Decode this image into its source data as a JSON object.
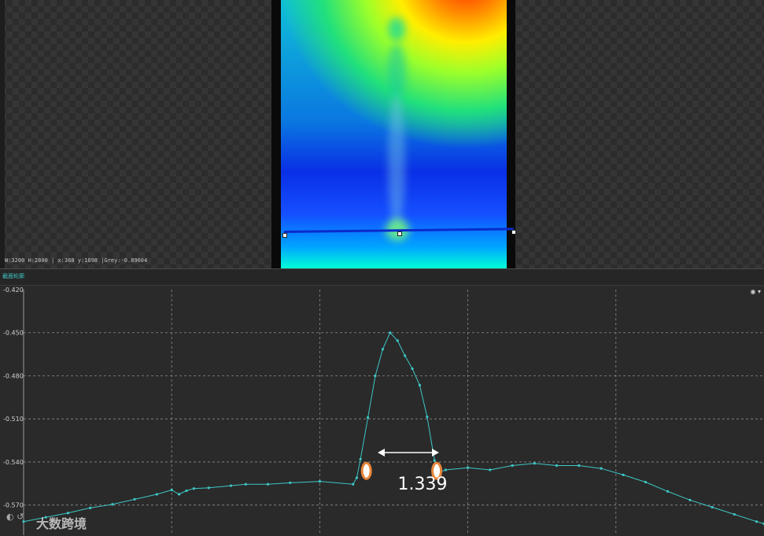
{
  "status_bar": {
    "text": "W:3200 H:2800 | x:368 y:1898 |Grey:-0.89604"
  },
  "profile_panel": {
    "tab_label": "截面轮廓",
    "icon_name": "eye-icon"
  },
  "annotation": {
    "label": "1.339"
  },
  "watermark": {
    "text": "大数跨境"
  },
  "colors": {
    "curve": "#3ec6c6",
    "grid": "#8a8a8a",
    "marker": "#e8863a"
  },
  "chart_data": {
    "type": "line",
    "title": "",
    "xlabel": "",
    "ylabel": "",
    "ylim": [
      -0.591,
      -0.42
    ],
    "yticks": [
      -0.42,
      -0.45,
      -0.48,
      -0.51,
      -0.54,
      -0.57
    ],
    "grid": true,
    "series": [
      {
        "x": [
          0,
          3,
          6,
          9,
          12,
          15,
          18,
          20,
          21,
          22,
          23,
          25,
          28,
          30,
          33,
          36,
          40,
          44.5,
          45,
          45.5,
          46.5,
          47.5,
          48.5,
          49.5,
          50.5,
          51.5,
          52.5,
          53.5,
          54.5,
          55.5,
          56,
          57,
          60,
          63,
          66,
          69,
          72,
          75,
          78,
          81,
          84,
          87,
          90,
          93,
          96,
          99,
          100
        ],
        "y": [
          -0.5815,
          -0.5785,
          -0.5755,
          -0.572,
          -0.5695,
          -0.566,
          -0.5625,
          -0.5595,
          -0.5625,
          -0.56,
          -0.5585,
          -0.558,
          -0.5565,
          -0.5555,
          -0.5555,
          -0.5545,
          -0.5535,
          -0.5555,
          -0.551,
          -0.538,
          -0.509,
          -0.48,
          -0.4615,
          -0.45,
          -0.4555,
          -0.466,
          -0.475,
          -0.4865,
          -0.5085,
          -0.539,
          -0.5475,
          -0.5455,
          -0.544,
          -0.5455,
          -0.5425,
          -0.541,
          -0.5425,
          -0.5425,
          -0.5445,
          -0.549,
          -0.554,
          -0.5605,
          -0.5665,
          -0.5715,
          -0.5765,
          -0.5815,
          -0.583
        ]
      }
    ],
    "markers": [
      {
        "x": 46.3,
        "y": -0.5462
      },
      {
        "x": 55.8,
        "y": -0.5462
      }
    ]
  }
}
